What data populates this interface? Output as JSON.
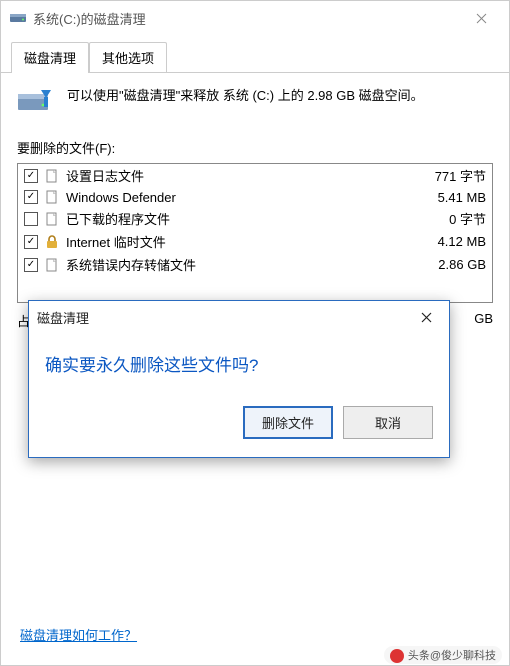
{
  "window": {
    "title": "系统(C:)的磁盘清理"
  },
  "tabs": {
    "active": "磁盘清理",
    "other": "其他选项"
  },
  "intro": "可以使用\"磁盘清理\"来释放 系统 (C:) 上的 2.98 GB 磁盘空间。",
  "section_label": "要删除的文件(F):",
  "files": [
    {
      "checked": true,
      "name": "设置日志文件",
      "size": "771 字节",
      "icon": "page"
    },
    {
      "checked": true,
      "name": "Windows Defender",
      "size": "5.41 MB",
      "icon": "page"
    },
    {
      "checked": false,
      "name": "已下载的程序文件",
      "size": "0 字节",
      "icon": "page"
    },
    {
      "checked": true,
      "name": "Internet 临时文件",
      "size": "4.12 MB",
      "icon": "lock"
    },
    {
      "checked": true,
      "name": "系统错误内存转储文件",
      "size": "2.86 GB",
      "icon": "page"
    }
  ],
  "totals": {
    "label": "占",
    "value": "GB"
  },
  "help_link": "磁盘清理如何工作？",
  "credit": "头条@俊少聊科技",
  "modal": {
    "title": "磁盘清理",
    "question": "确实要永久删除这些文件吗?",
    "confirm": "删除文件",
    "cancel": "取消"
  }
}
